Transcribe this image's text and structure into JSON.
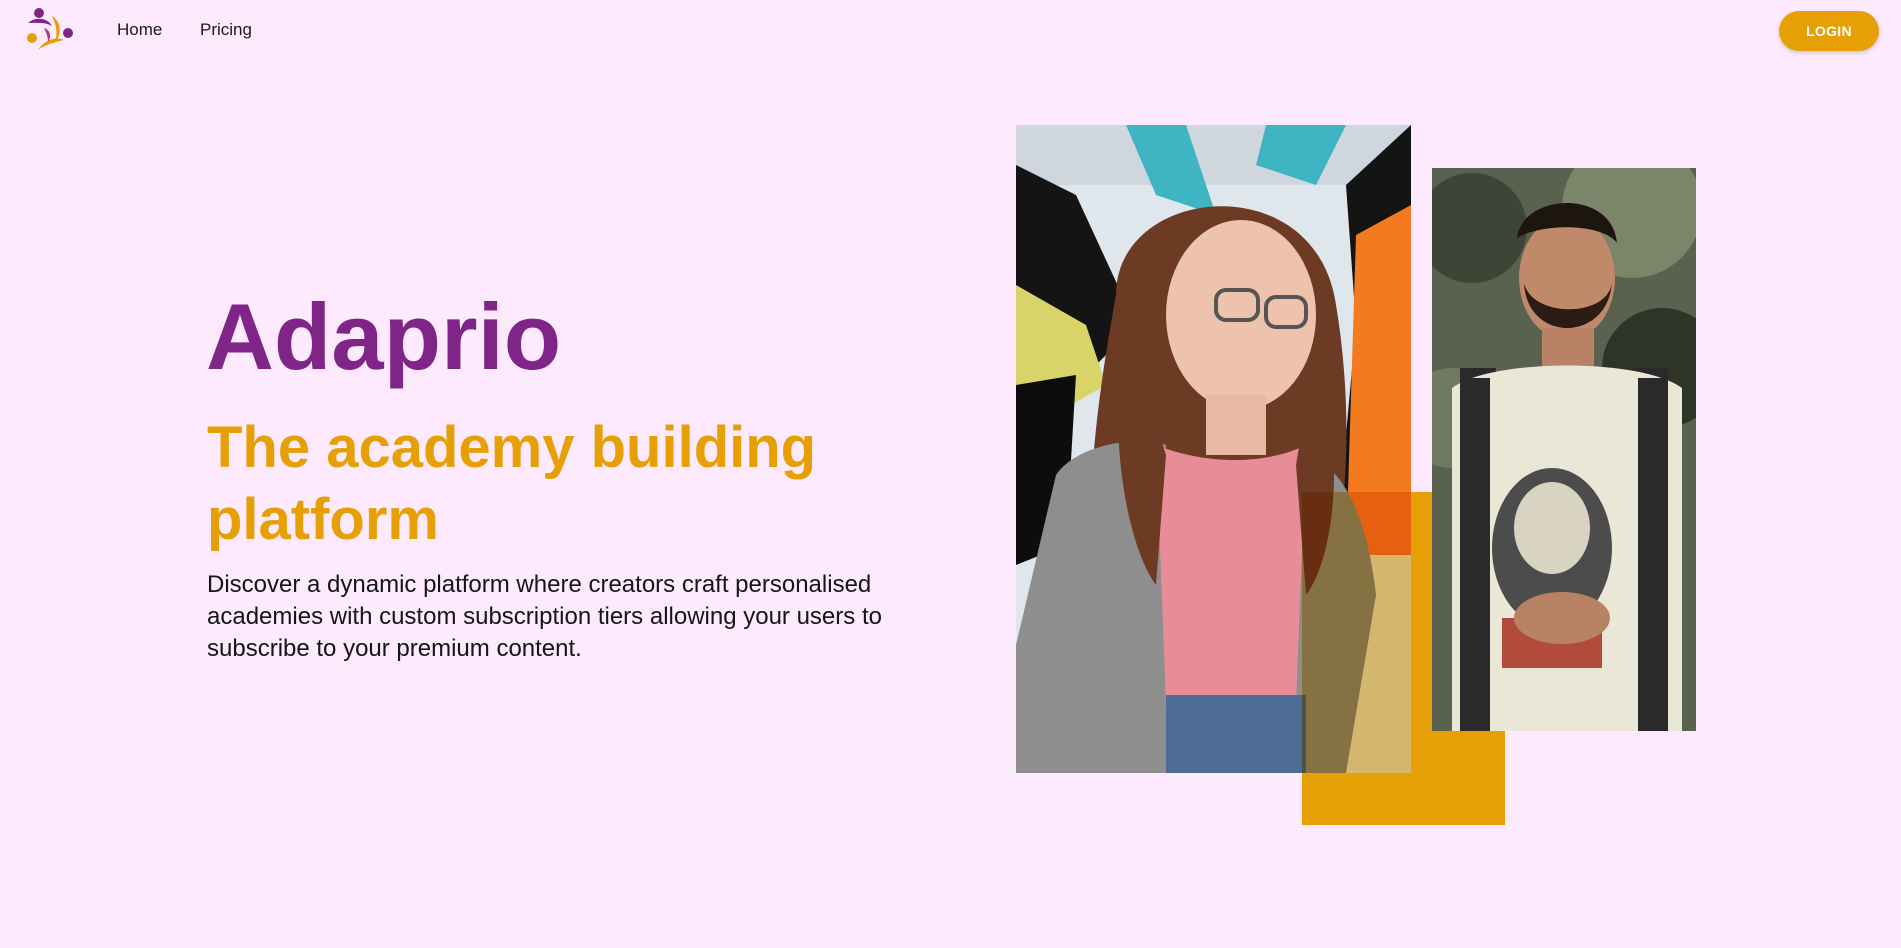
{
  "nav": {
    "logo_icon": "adaprio-logo-icon",
    "links": [
      {
        "label": "Home"
      },
      {
        "label": "Pricing"
      }
    ],
    "login_label": "LOGIN"
  },
  "hero": {
    "title": "Adaprio",
    "subtitle": "The academy building platform",
    "description": "Discover a dynamic platform where creators craft personalised academies with custom subscription tiers allowing your users to subscribe to your premium content."
  },
  "images": {
    "woman": "photo-woman-glasses",
    "man": "photo-man-beard"
  },
  "colors": {
    "background": "#fdeafe",
    "primary": "#7e2587",
    "accent": "#e6a006"
  }
}
